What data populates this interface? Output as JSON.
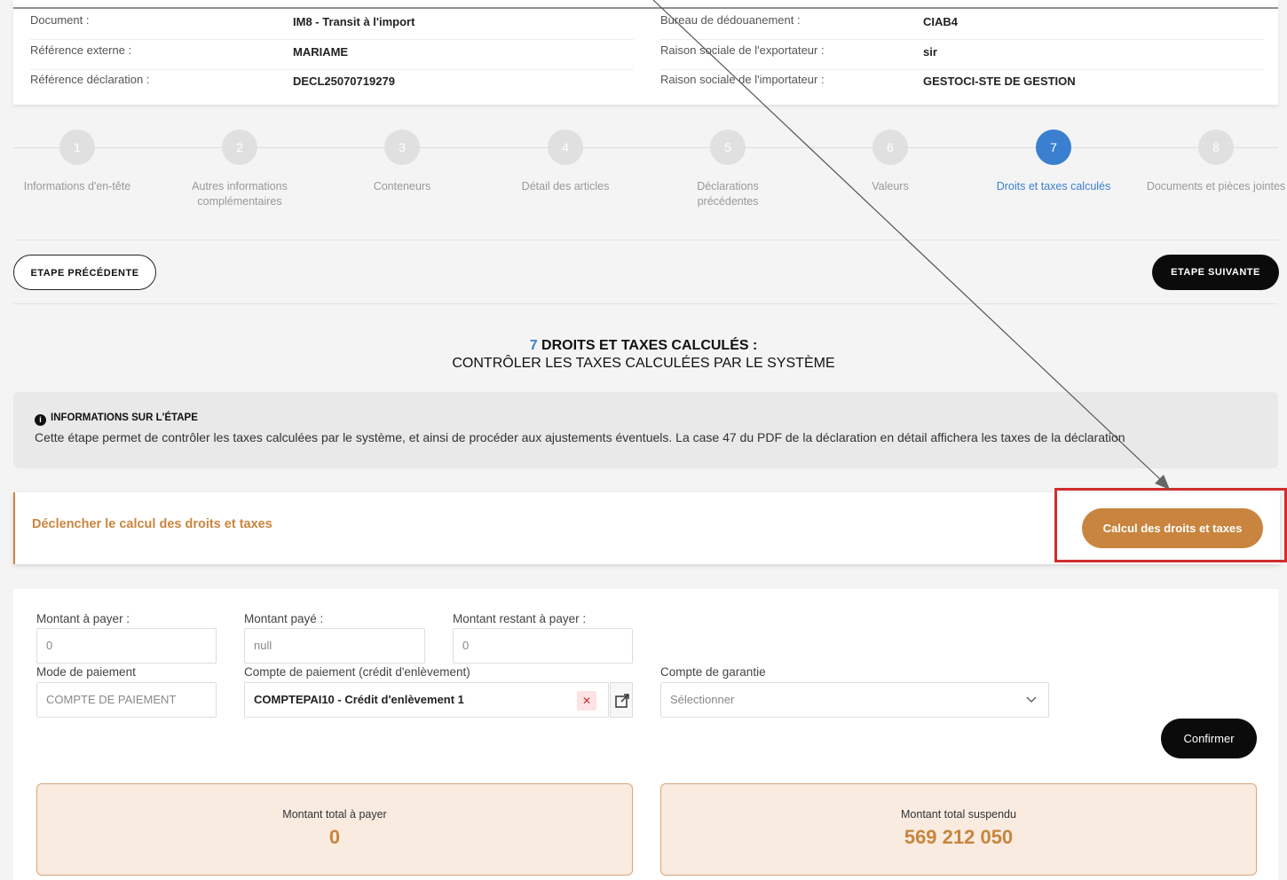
{
  "header": {
    "rows_left": [
      {
        "label": "Document :",
        "value": "IM8 - Transit à l'import"
      },
      {
        "label": "Référence externe :",
        "value": "MARIAME"
      },
      {
        "label": "Référence déclaration :",
        "value": "DECL25070719279"
      }
    ],
    "rows_right": [
      {
        "label": "Bureau de dédouanement :",
        "value": "CIAB4"
      },
      {
        "label": "Raison sociale de l'exportateur :",
        "value": "sir"
      },
      {
        "label": "Raison sociale de l'importateur :",
        "value": "GESTOCI-STE DE GESTION"
      }
    ]
  },
  "stepper": {
    "active_step": 7,
    "steps": [
      {
        "number": "1",
        "label": "Informations d'en-tête"
      },
      {
        "number": "2",
        "label": "Autres informations complémentaires"
      },
      {
        "number": "3",
        "label": "Conteneurs"
      },
      {
        "number": "4",
        "label": "Détail des articles"
      },
      {
        "number": "5",
        "label": "Déclarations précédentes"
      },
      {
        "number": "6",
        "label": "Valeurs"
      },
      {
        "number": "7",
        "label": "Droits et taxes calculés"
      },
      {
        "number": "8",
        "label": "Documents et pièces jointes"
      }
    ]
  },
  "nav": {
    "prev_label": "ETAPE PRÉCÉDENTE",
    "next_label": "ETAPE SUIVANTE"
  },
  "section_title": {
    "number": "7",
    "title": "DROITS ET TAXES CALCULÉS :",
    "subtitle": "CONTRÔLER LES TAXES CALCULÉES PAR LE SYSTÈME"
  },
  "info_box": {
    "heading": "INFORMATIONS SUR L'ÉTAPE",
    "text": "Cette étape permet de contrôler les taxes calculées par le système, et ainsi de procéder aux ajustements éventuels. La case 47 du PDF de la déclaration en détail affichera les taxes de la déclaration"
  },
  "calc": {
    "text": "Déclencher le calcul des droits et taxes",
    "button_label": "Calcul des droits et taxes"
  },
  "form": {
    "montant_a_payer": {
      "label": "Montant à payer :",
      "value": "0"
    },
    "montant_paye": {
      "label": "Montant payé :",
      "value": "null"
    },
    "montant_restant": {
      "label": "Montant restant à payer :",
      "value": "0"
    },
    "mode_paiement": {
      "label": "Mode de paiement",
      "value": "COMPTE DE PAIEMENT"
    },
    "compte_paiement": {
      "label": "Compte de paiement (crédit d'enlèvement)",
      "value": "COMPTEPAI10 - Crédit d'enlèvement 1"
    },
    "compte_garantie": {
      "label": "Compte de garantie",
      "placeholder": "Sélectionner"
    },
    "confirm_label": "Confirmer"
  },
  "totals": {
    "total_a_payer": {
      "label": "Montant total à payer",
      "value": "0"
    },
    "total_suspendu": {
      "label": "Montant total suspendu",
      "value": "569 212 050"
    }
  },
  "colors": {
    "accent": "#c9853f",
    "active_step": "#3a7fd0",
    "highlight": "#d12d2d"
  }
}
